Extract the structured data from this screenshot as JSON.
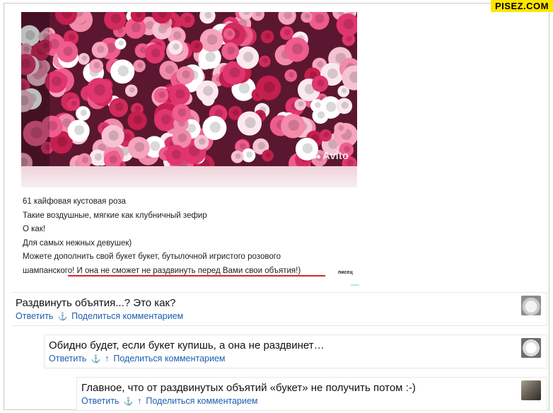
{
  "watermark": "PISEZ.COM",
  "post": {
    "photo_watermark": "Avito",
    "lines": [
      "61 кайфовая кустовая роза",
      "Такие воздушные, мягкие как клубничный зефир",
      "О как!",
      "Для самых нежных девушек)",
      "Можете дополнить свой букет букет, бутылочной игристого розового",
      "шампанского! И она не сможет не раздвинуть перед Вами свои объятия!)"
    ],
    "stamp": "писец"
  },
  "comments": [
    {
      "text": "Раздвинуть объятия...? Это как?",
      "reply": "Ответить",
      "anchor": "⚓",
      "up": "",
      "share": "Поделиться комментарием",
      "avatar": "cat-avatar"
    },
    {
      "text": "Обидно будет, если букет купишь, а она не раздвинет…",
      "reply": "Ответить",
      "anchor": "⚓",
      "up": "↑",
      "share": "Поделиться комментарием",
      "avatar": "white-cat-avatar"
    },
    {
      "text": "Главное, что от раздвинутых объятий «букет» не получить потом :-)",
      "reply": "Ответить",
      "anchor": "⚓",
      "up": "↑",
      "share": "Поделиться комментарием",
      "avatar": "person-avatar"
    }
  ],
  "colors": {
    "link": "#1c5fb0",
    "underline": "#d9262b",
    "watermark_bg": "#ffe600"
  }
}
